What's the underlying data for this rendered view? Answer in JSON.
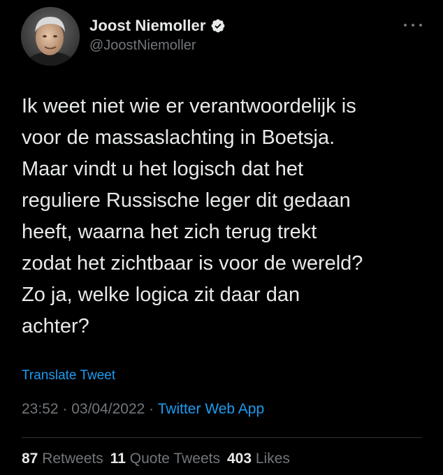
{
  "author": {
    "display_name": "Joost Niemoller",
    "handle": "@JoostNiemoller",
    "verified": true,
    "avatar_icon": "profile-photo",
    "more_icon": "ellipsis-icon"
  },
  "tweet": {
    "text": "Ik weet niet wie er verantwoordelijk is\nvoor de massaslachting in Boetsja.\nMaar vindt u het logisch dat het\nreguliere Russische leger dit gedaan\nheeft, waarna het zich terug trekt\nzodat het zichtbaar is voor de wereld?\nZo ja, welke logica zit daar dan\nachter?",
    "translate_label": "Translate Tweet"
  },
  "meta": {
    "time": "23:52",
    "separator1": " · ",
    "date": "03/04/2022",
    "separator2": " · ",
    "source": "Twitter Web App"
  },
  "stats": {
    "retweets_count": "87",
    "retweets_label": " Retweets",
    "quotes_count": "11",
    "quotes_label": " Quote Tweets",
    "likes_count": "403",
    "likes_label": " Likes"
  },
  "colors": {
    "background": "#000000",
    "text": "#e7e9ea",
    "secondary": "#71767b",
    "accent": "#1d9bf0",
    "divider": "#2f3336"
  }
}
